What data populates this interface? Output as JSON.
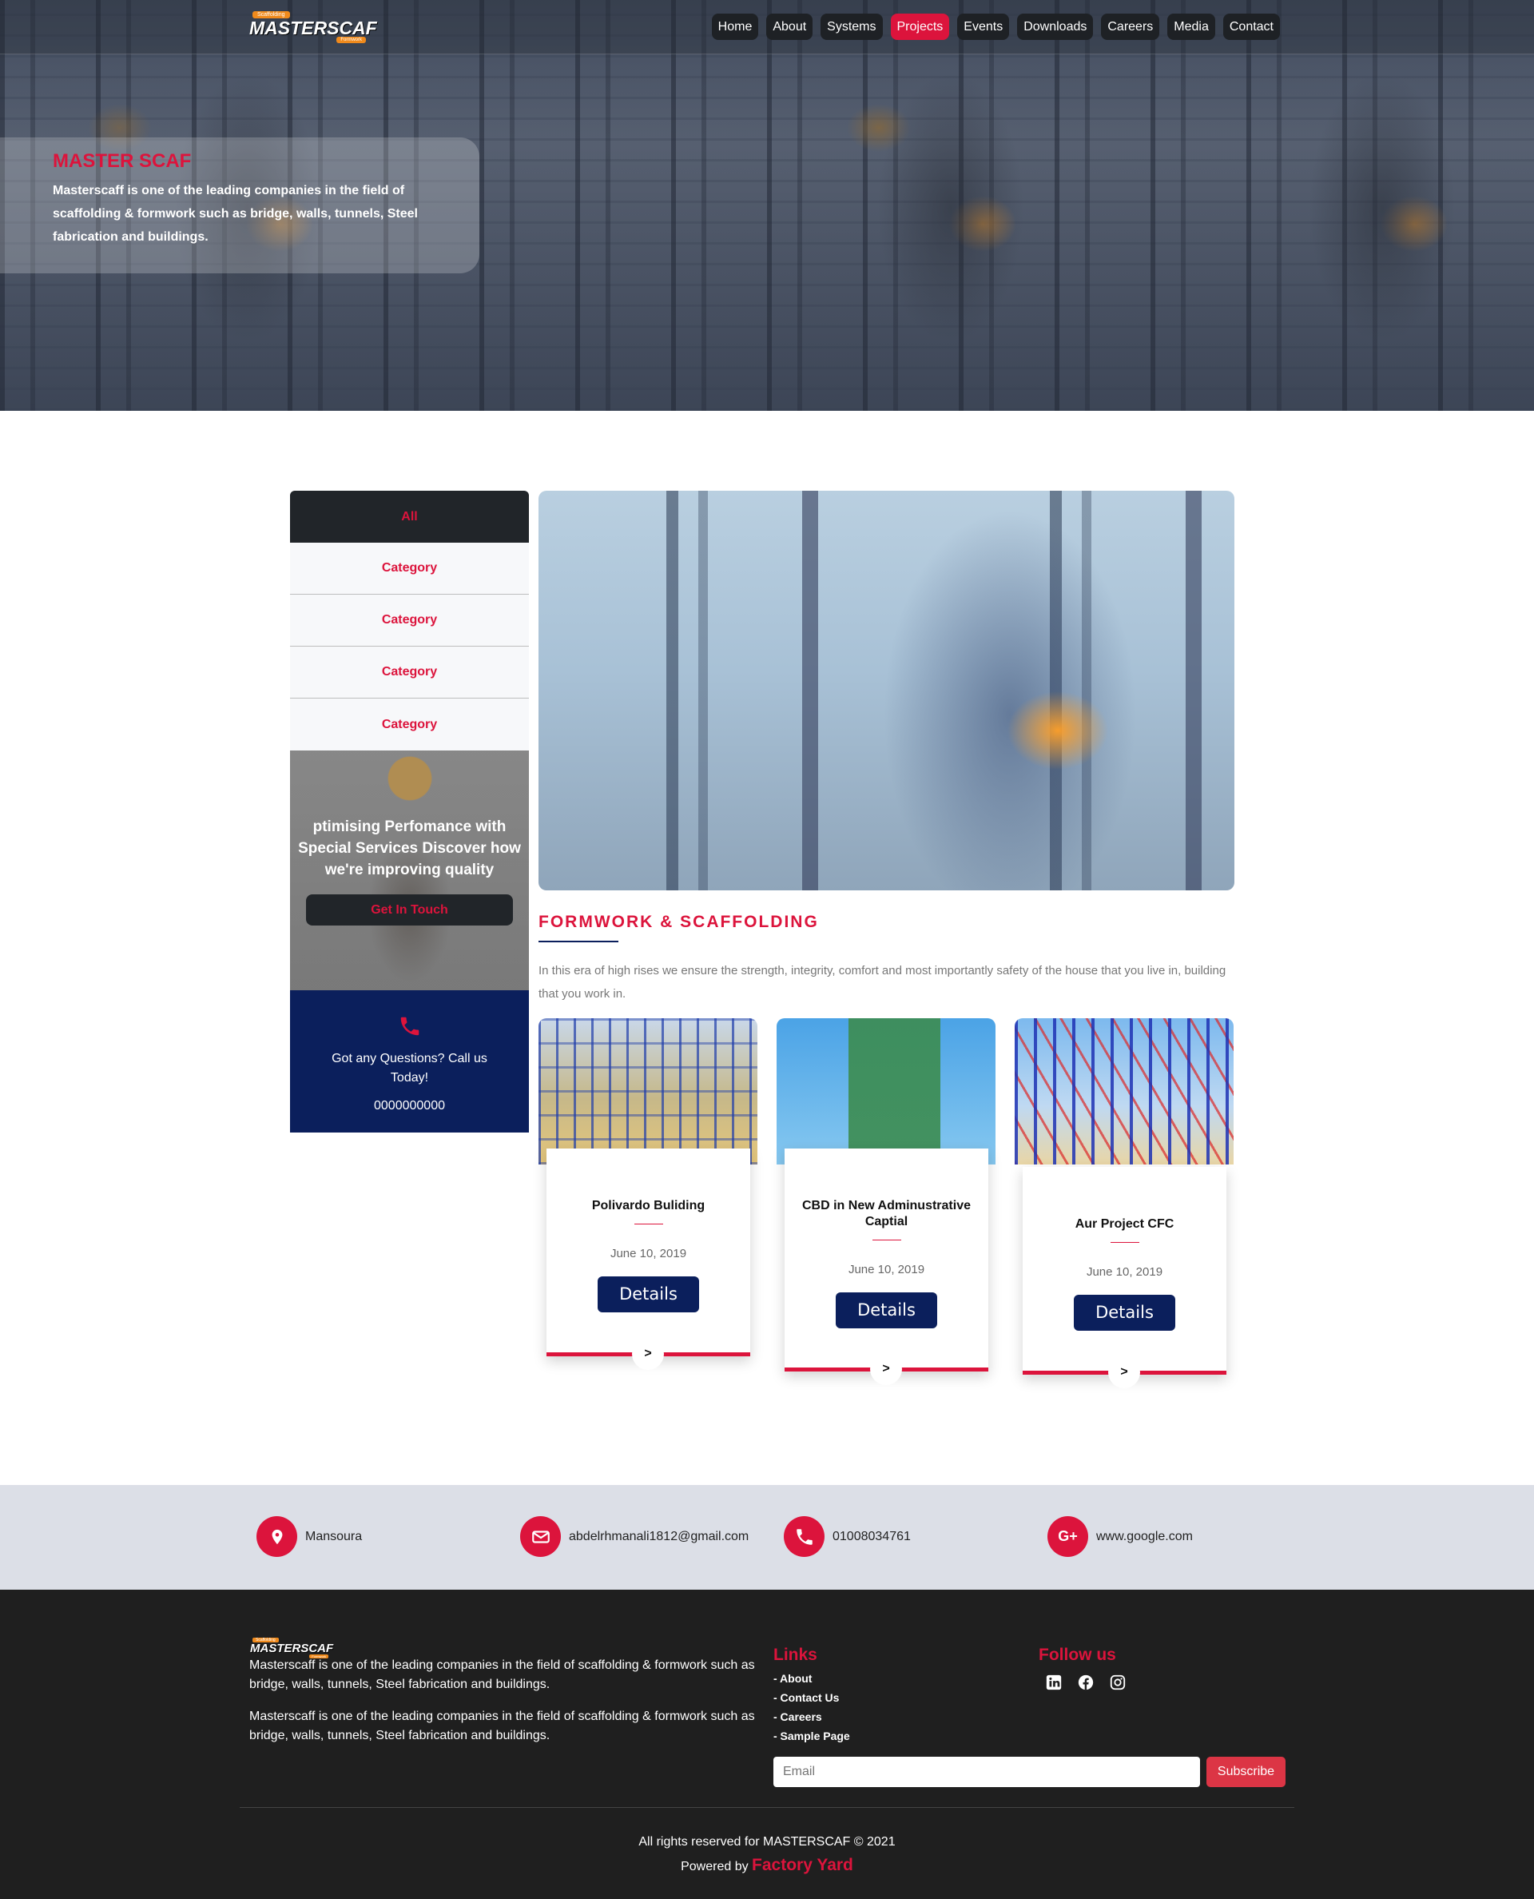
{
  "brand": {
    "name": "MASTERSCAF",
    "tag_top": "Scaffolding",
    "tag_bottom": "Formwork"
  },
  "nav": [
    {
      "label": "Home",
      "active": false
    },
    {
      "label": "About",
      "active": false
    },
    {
      "label": "Systems",
      "active": false
    },
    {
      "label": "Projects",
      "active": true
    },
    {
      "label": "Events",
      "active": false
    },
    {
      "label": "Downloads",
      "active": false
    },
    {
      "label": "Careers",
      "active": false
    },
    {
      "label": "Media",
      "active": false
    },
    {
      "label": "Contact",
      "active": false
    }
  ],
  "hero": {
    "title": "MASTER SCAF",
    "text": "Masterscaff is one of the leading companies in the field of scaffolding & formwork such as bridge, walls, tunnels, Steel fabrication and buildings."
  },
  "sidebar": {
    "categories": [
      "All",
      "Category",
      "Category",
      "Category",
      "Category"
    ],
    "promo_text": "ptimising Perfomance with Special Services Discover how we're improving quality",
    "promo_button": "Get In Touch",
    "call_text": "Got any Questions? Call us Today!",
    "call_number": "0000000000"
  },
  "main": {
    "section_title": "FORMWORK & SCAFFOLDING",
    "intro": "In this era of high rises we ensure the strength, integrity, comfort and most importantly safety of the house that you live in, building that you work in."
  },
  "projects": [
    {
      "title": "Polivardo Buliding",
      "date": "June 10, 2019",
      "button": "Details",
      "arrow": ">"
    },
    {
      "title": "CBD in New Adminustrative Captial",
      "date": "June 10, 2019",
      "button": "Details",
      "arrow": ">"
    },
    {
      "title": "Aur Project CFC",
      "date": "June 10, 2019",
      "button": "Details",
      "arrow": ">"
    }
  ],
  "contact": {
    "location": "Mansoura",
    "email": "abdelrhmanali1812@gmail.com",
    "phone": "01008034761",
    "website": "www.google.com"
  },
  "footer": {
    "about_1": "Masterscaff is one of the leading companies in the field of scaffolding & formwork such as bridge, walls, tunnels, Steel fabrication and buildings.",
    "about_2": "Masterscaff is one of the leading companies in the field of scaffolding & formwork such as bridge, walls, tunnels, Steel fabrication and buildings.",
    "links_title": "Links",
    "links": [
      "- About",
      "- Contact Us",
      "- Careers",
      "- Sample Page"
    ],
    "follow_title": "Follow us",
    "social_icons": [
      "linkedin-icon",
      "facebook-icon",
      "instagram-icon"
    ],
    "email_placeholder": "Email",
    "subscribe_label": "Subscribe",
    "copyright": "All rights reserved for MASTERSCAF © 2021",
    "powered_prefix": "Powered by",
    "powered_name": "Factory Yard"
  },
  "colors": {
    "accent": "#dc143c",
    "navy": "#0b1f5c",
    "dark": "#212529",
    "strip": "#dcdfe7",
    "footer": "#1f1f1f"
  }
}
